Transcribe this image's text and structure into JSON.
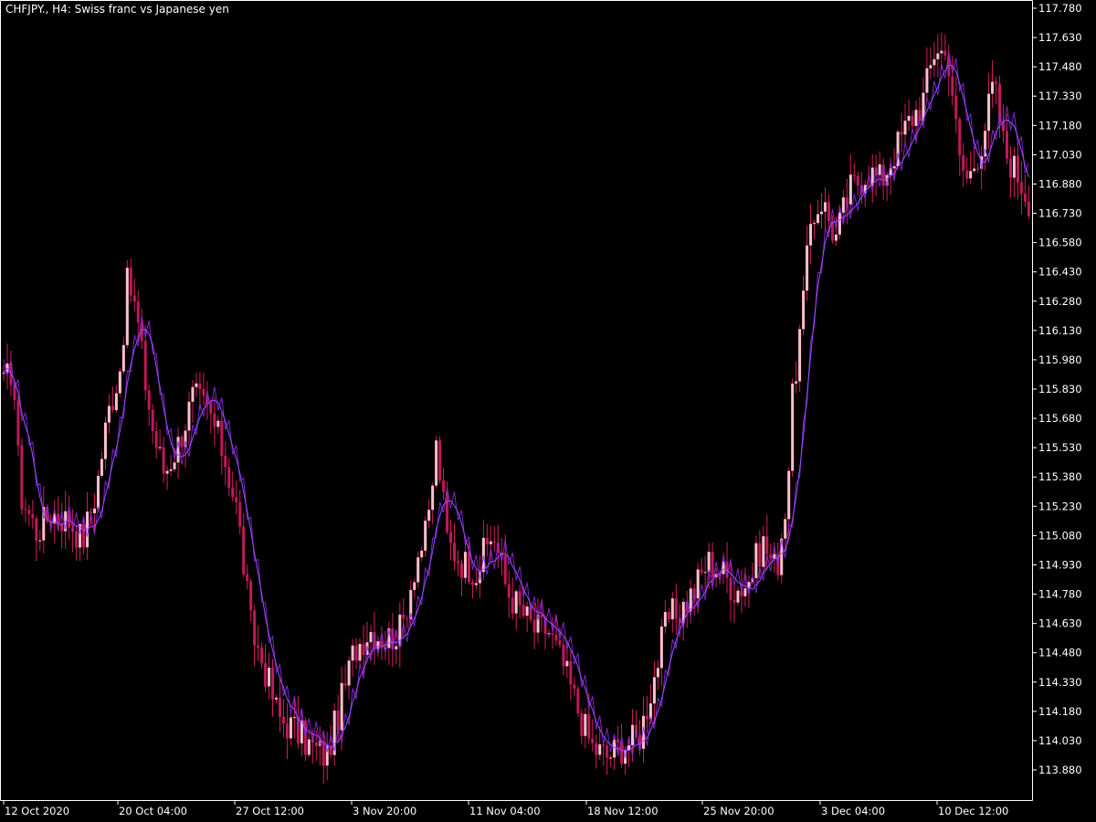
{
  "header": {
    "title": "CHFJPY., H4:  Swiss franc vs Japanese yen"
  },
  "colors": {
    "background": "#000000",
    "frame": "#ffffff",
    "bull_candle": "#ffc0cb",
    "bear_candle": "#c2185b",
    "wick": "#d81b60",
    "ma_line": "#8a2be2",
    "text": "#ffffff"
  },
  "chart_data": {
    "type": "line",
    "symbol": "CHFJPY.",
    "timeframe": "H4",
    "description": "Swiss franc vs Japanese yen",
    "y_ticks": [
      "117.780",
      "117.630",
      "117.480",
      "117.330",
      "117.180",
      "117.030",
      "116.880",
      "116.730",
      "116.580",
      "116.430",
      "116.280",
      "116.130",
      "115.980",
      "115.830",
      "115.680",
      "115.530",
      "115.380",
      "115.230",
      "115.080",
      "114.930",
      "114.780",
      "114.630",
      "114.480",
      "114.330",
      "114.180",
      "114.030",
      "113.880"
    ],
    "x_ticks": [
      "12 Oct 2020",
      "20 Oct 04:00",
      "27 Oct 12:00",
      "3 Nov 20:00",
      "11 Nov 04:00",
      "18 Nov 12:00",
      "25 Nov 20:00",
      "3 Dec 04:00",
      "10 Dec 12:00"
    ],
    "ylim": [
      113.83,
      117.8
    ],
    "grid": false,
    "price_path": [
      [
        0,
        115.8
      ],
      [
        14,
        115.95
      ],
      [
        22,
        115.3
      ],
      [
        40,
        115.1
      ],
      [
        56,
        115.2
      ],
      [
        78,
        115.15
      ],
      [
        90,
        115.05
      ],
      [
        105,
        115.3
      ],
      [
        118,
        115.7
      ],
      [
        132,
        115.95
      ],
      [
        140,
        116.4
      ],
      [
        150,
        116.2
      ],
      [
        158,
        115.9
      ],
      [
        168,
        115.6
      ],
      [
        180,
        115.4
      ],
      [
        195,
        115.55
      ],
      [
        212,
        115.8
      ],
      [
        230,
        115.7
      ],
      [
        245,
        115.5
      ],
      [
        260,
        115.2
      ],
      [
        275,
        114.6
      ],
      [
        290,
        114.4
      ],
      [
        305,
        114.15
      ],
      [
        320,
        114.1
      ],
      [
        340,
        114.0
      ],
      [
        358,
        113.95
      ],
      [
        372,
        114.2
      ],
      [
        388,
        114.5
      ],
      [
        405,
        114.6
      ],
      [
        422,
        114.55
      ],
      [
        440,
        114.6
      ],
      [
        455,
        114.95
      ],
      [
        468,
        115.1
      ],
      [
        478,
        115.55
      ],
      [
        490,
        115.05
      ],
      [
        505,
        114.95
      ],
      [
        522,
        114.9
      ],
      [
        540,
        115.1
      ],
      [
        555,
        114.8
      ],
      [
        570,
        114.7
      ],
      [
        585,
        114.6
      ],
      [
        600,
        114.6
      ],
      [
        618,
        114.4
      ],
      [
        632,
        114.2
      ],
      [
        648,
        114.0
      ],
      [
        665,
        113.95
      ],
      [
        680,
        114.0
      ],
      [
        700,
        114.05
      ],
      [
        716,
        114.35
      ],
      [
        730,
        114.65
      ],
      [
        745,
        114.7
      ],
      [
        760,
        114.8
      ],
      [
        775,
        114.95
      ],
      [
        790,
        114.9
      ],
      [
        805,
        114.8
      ],
      [
        820,
        114.85
      ],
      [
        835,
        115.05
      ],
      [
        850,
        114.9
      ],
      [
        862,
        115.3
      ],
      [
        868,
        115.8
      ],
      [
        878,
        116.2
      ],
      [
        888,
        116.7
      ],
      [
        900,
        116.8
      ],
      [
        915,
        116.6
      ],
      [
        930,
        116.85
      ],
      [
        950,
        116.95
      ],
      [
        965,
        116.9
      ],
      [
        980,
        117.05
      ],
      [
        995,
        117.2
      ],
      [
        1010,
        117.3
      ],
      [
        1025,
        117.6
      ],
      [
        1040,
        117.5
      ],
      [
        1050,
        117.0
      ],
      [
        1060,
        116.9
      ],
      [
        1075,
        117.1
      ],
      [
        1088,
        117.4
      ],
      [
        1100,
        117.05
      ],
      [
        1112,
        116.95
      ],
      [
        1127,
        116.8
      ]
    ]
  }
}
